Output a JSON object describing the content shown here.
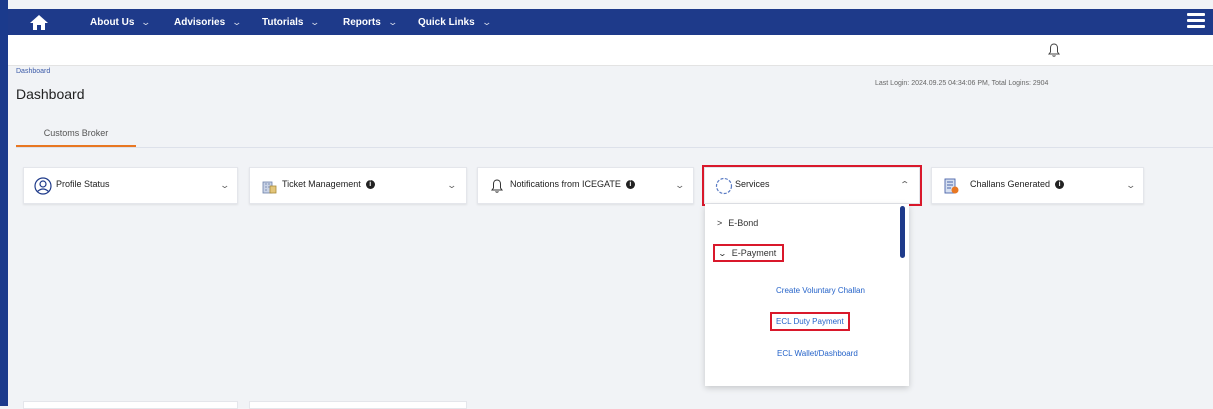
{
  "nav": {
    "items": [
      {
        "label": "About Us"
      },
      {
        "label": "Advisories"
      },
      {
        "label": "Tutorials"
      },
      {
        "label": "Reports"
      },
      {
        "label": "Quick Links"
      }
    ]
  },
  "breadcrumb": "Dashboard",
  "page_title": "Dashboard",
  "last_login": "Last Login: 2024.09.25 04:34:06 PM, Total Logins: 2904",
  "tabs": [
    {
      "label": "Customs Broker"
    }
  ],
  "cards": [
    {
      "label": "Profile Status",
      "icon": "profile-icon"
    },
    {
      "label": "Ticket Management",
      "icon": "building-icon"
    },
    {
      "label": "Notifications from ICEGATE",
      "icon": "bell-icon"
    },
    {
      "label": "Services",
      "icon": "gear-icon"
    },
    {
      "label": "Challans Generated",
      "icon": "challan-icon"
    }
  ],
  "services_menu": {
    "items": [
      {
        "label": "E-Bond",
        "expanded": false
      },
      {
        "label": "E-Payment",
        "expanded": true
      }
    ],
    "links": [
      {
        "label": "Create Voluntary Challan"
      },
      {
        "label": "ECL Duty Payment"
      },
      {
        "label": "ECL Wallet/Dashboard"
      }
    ]
  },
  "colors": {
    "nav_bg": "#1e3a8a",
    "accent": "#e87722",
    "highlight": "#d9182b",
    "link": "#2563c9"
  }
}
